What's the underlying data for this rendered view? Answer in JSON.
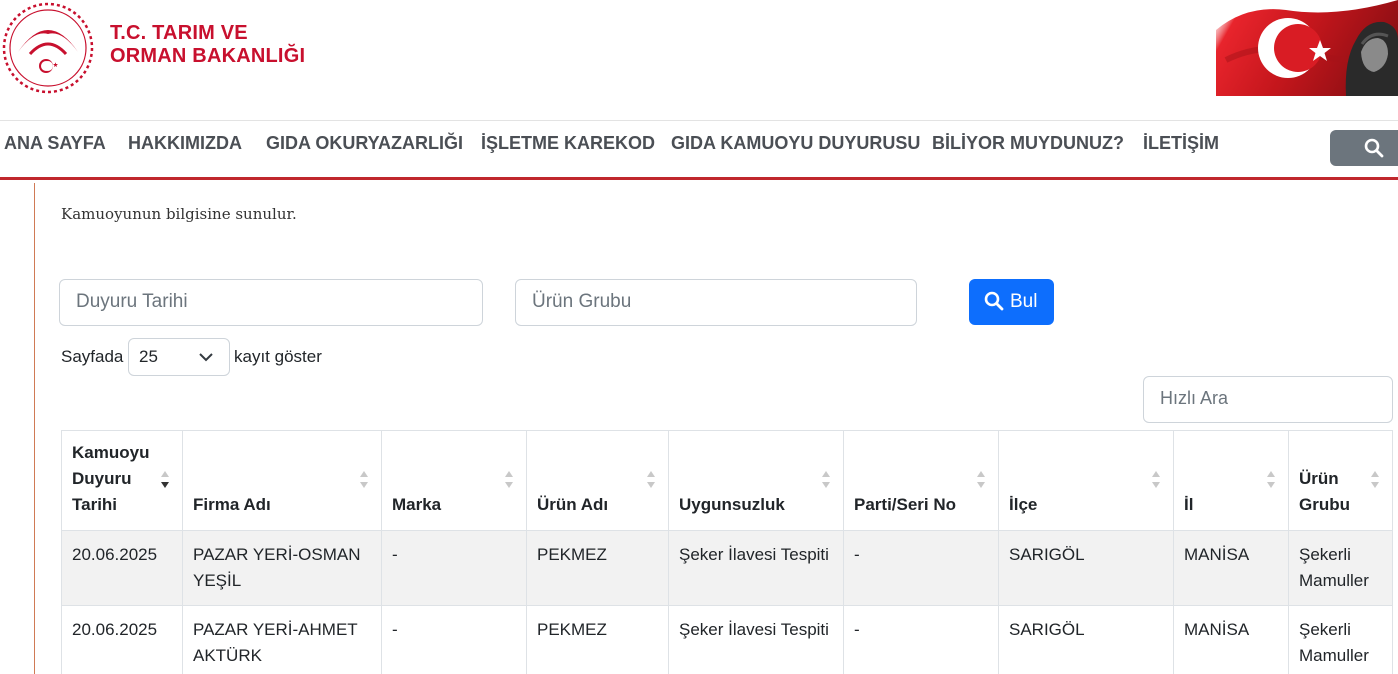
{
  "header": {
    "ministry_line1": "T.C. TARIM VE",
    "ministry_line2": "ORMAN BAKANLIĞI",
    "logo_icon": "ministry-emblem-icon",
    "banner_icon": "turkish-flag-ataturk-banner"
  },
  "nav": {
    "items": [
      {
        "label": "ANA SAYFA"
      },
      {
        "label": "HAKKIMIZDA"
      },
      {
        "label": "GIDA OKURYAZARLIĞI"
      },
      {
        "label": "İŞLETME KAREKOD"
      },
      {
        "label": "GIDA KAMUOYU DUYURUSU"
      },
      {
        "label": "BİLİYOR MUYDUNUZ?"
      },
      {
        "label": "İLETİŞİM"
      }
    ],
    "search_icon": "search-icon"
  },
  "content": {
    "notice": "Kamuoyunun bilgisine sunulur."
  },
  "filters": {
    "date_placeholder": "Duyuru Tarihi",
    "group_placeholder": "Ürün Grubu",
    "search_label": "Bul"
  },
  "length": {
    "prefix": "Sayfada",
    "value": "25",
    "suffix": "kayıt göster"
  },
  "quick_search": {
    "placeholder": "Hızlı Ara"
  },
  "table": {
    "columns": [
      {
        "label": "Kamuoyu Duyuru Tarihi",
        "sorted": "desc"
      },
      {
        "label": "Firma Adı"
      },
      {
        "label": "Marka"
      },
      {
        "label": "Ürün Adı"
      },
      {
        "label": "Uygunsuzluk"
      },
      {
        "label": "Parti/Seri No"
      },
      {
        "label": "İlçe"
      },
      {
        "label": "İl"
      },
      {
        "label": "Ürün Grubu"
      }
    ],
    "rows": [
      [
        "20.06.2025",
        "PAZAR YERİ-OSMAN YEŞİL",
        "-",
        "PEKMEZ",
        "Şeker İlavesi Tespiti",
        "-",
        "SARIGÖL",
        "MANİSA",
        "Şekerli Mamuller"
      ],
      [
        "20.06.2025",
        "PAZAR YERİ-AHMET AKTÜRK",
        "-",
        "PEKMEZ",
        "Şeker İlavesi Tespiti",
        "-",
        "SARIGÖL",
        "MANİSA",
        "Şekerli Mamuller"
      ]
    ]
  },
  "colors": {
    "brand_red": "#c8102e",
    "nav_border": "#c0272d",
    "primary_blue": "#0d6efd",
    "search_gray": "#6c757d"
  }
}
